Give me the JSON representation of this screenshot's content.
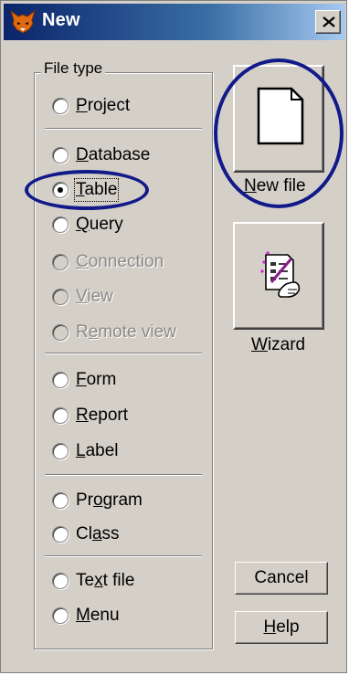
{
  "window": {
    "title": "New",
    "close_glyph": "×"
  },
  "file_type": {
    "legend": "File type",
    "options": [
      {
        "pre": "",
        "mnemonic": "P",
        "post": "roject",
        "state": "normal"
      },
      {
        "pre": "",
        "mnemonic": "D",
        "post": "atabase",
        "state": "normal"
      },
      {
        "pre": "",
        "mnemonic": "T",
        "post": "able",
        "state": "checked"
      },
      {
        "pre": "",
        "mnemonic": "Q",
        "post": "uery",
        "state": "normal"
      },
      {
        "pre": "",
        "mnemonic": "C",
        "post": "onnection",
        "state": "disabled"
      },
      {
        "pre": "",
        "mnemonic": "V",
        "post": "iew",
        "state": "disabled"
      },
      {
        "pre": "R",
        "mnemonic": "e",
        "post": "mote view",
        "state": "disabled"
      },
      {
        "pre": "",
        "mnemonic": "F",
        "post": "orm",
        "state": "normal"
      },
      {
        "pre": "",
        "mnemonic": "R",
        "post": "eport",
        "state": "normal"
      },
      {
        "pre": "",
        "mnemonic": "L",
        "post": "abel",
        "state": "normal"
      },
      {
        "pre": "Pr",
        "mnemonic": "o",
        "post": "gram",
        "state": "normal"
      },
      {
        "pre": "Cl",
        "mnemonic": "a",
        "post": "ss",
        "state": "normal"
      },
      {
        "pre": "Te",
        "mnemonic": "x",
        "post": "t file",
        "state": "normal"
      },
      {
        "pre": "",
        "mnemonic": "M",
        "post": "enu",
        "state": "normal"
      }
    ],
    "selected": "Table"
  },
  "buttons": {
    "new_file": {
      "pre": "",
      "mnemonic": "N",
      "post": "ew file",
      "icon": "blank-document-icon"
    },
    "wizard": {
      "pre": "",
      "mnemonic": "W",
      "post": "izard",
      "icon": "wizard-wand-icon"
    },
    "cancel": {
      "label": "Cancel"
    },
    "help": {
      "pre": "",
      "mnemonic": "H",
      "post": "elp"
    }
  },
  "annotations": {
    "color": "#121a8a",
    "circled": [
      "Table",
      "New file"
    ]
  },
  "colors": {
    "dialog_face": "#d4d0c8",
    "title_bar_start": "#0a246a",
    "title_bar_end": "#a6caf0",
    "disabled_text": "#8c8a86"
  }
}
